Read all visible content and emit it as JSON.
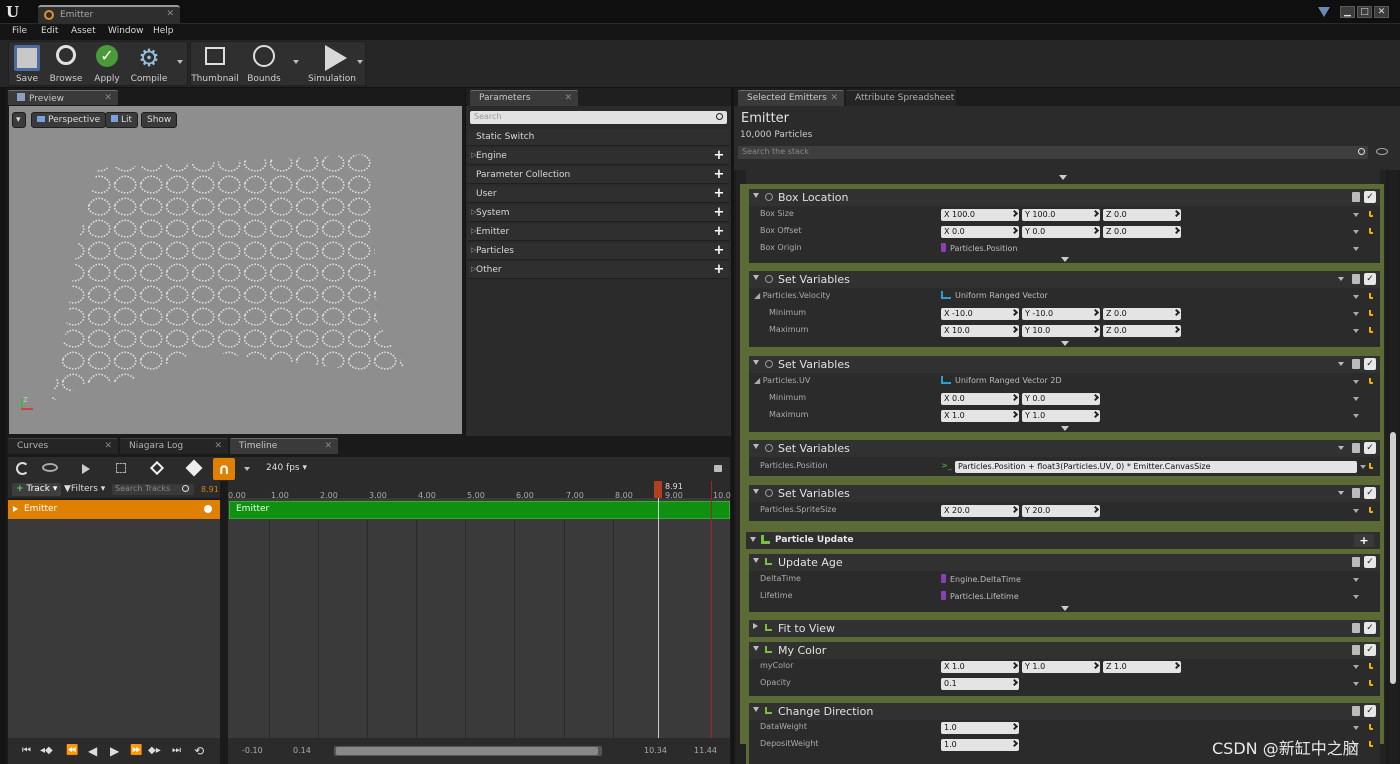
{
  "window": {
    "tab_title": "Emitter"
  },
  "menu": [
    "File",
    "Edit",
    "Asset",
    "Window",
    "Help"
  ],
  "toolbar": {
    "save": "Save",
    "browse": "Browse",
    "apply": "Apply",
    "compile": "Compile",
    "thumbnail": "Thumbnail",
    "bounds": "Bounds",
    "simulation": "Simulation"
  },
  "preview": {
    "tab": "Preview",
    "perspective": "Perspective",
    "lit": "Lit",
    "show": "Show"
  },
  "parameters": {
    "tab": "Parameters",
    "search_placeholder": "Search",
    "items": [
      "Static Switch",
      "Engine",
      "Parameter Collection",
      "User",
      "System",
      "Emitter",
      "Particles",
      "Other"
    ]
  },
  "right_tabs": {
    "selected_emitters": "Selected Emitters",
    "attribute_spreadsheet": "Attribute Spreadsheet"
  },
  "emitter": {
    "name": "Emitter",
    "particles": "10,000 Particles",
    "search_placeholder": "Search the stack"
  },
  "modules": {
    "box_location": {
      "title": "Box Location",
      "box_size": "Box Size",
      "box_offset": "Box Offset",
      "box_origin": "Box Origin",
      "size_x": "X 100.0",
      "size_y": "Y 100.0",
      "size_z": "Z 0.0",
      "off_x": "X 0.0",
      "off_y": "Y 0.0",
      "off_z": "Z 0.0",
      "origin": "Particles.Position"
    },
    "set_vars_velocity": {
      "title": "Set Variables",
      "param": "Particles.Velocity",
      "type": "Uniform Ranged Vector",
      "min": "Minimum",
      "max": "Maximum",
      "min_x": "X -10.0",
      "min_y": "Y -10.0",
      "min_z": "Z 0.0",
      "max_x": "X 10.0",
      "max_y": "Y 10.0",
      "max_z": "Z 0.0"
    },
    "set_vars_uv": {
      "title": "Set Variables",
      "param": "Particles.UV",
      "type": "Uniform Ranged Vector 2D",
      "min": "Minimum",
      "max": "Maximum",
      "min_x": "X 0.0",
      "min_y": "Y 0.0",
      "max_x": "X 1.0",
      "max_y": "Y 1.0"
    },
    "set_vars_position": {
      "title": "Set Variables",
      "param": "Particles.Position",
      "expr": "Particles.Position + float3(Particles.UV, 0) * Emitter.CanvasSize"
    },
    "set_vars_sprite": {
      "title": "Set Variables",
      "param": "Particles.SpriteSize",
      "x": "X 20.0",
      "y": "Y 20.0"
    },
    "particle_update": {
      "title": "Particle Update"
    },
    "update_age": {
      "title": "Update Age",
      "delta": "DeltaTime",
      "delta_val": "Engine.DeltaTime",
      "lifetime": "Lifetime",
      "lifetime_val": "Particles.Lifetime"
    },
    "fit_to_view": {
      "title": "Fit to View"
    },
    "my_color": {
      "title": "My Color",
      "color": "myColor",
      "x": "X 1.0",
      "y": "Y 1.0",
      "z": "Z 1.0",
      "opacity": "Opacity",
      "opacity_val": "0.1"
    },
    "change_direction": {
      "title": "Change Direction",
      "data_weight": "DataWeight",
      "dw_val": "1.0",
      "deposit_weight": "DepositWeight",
      "dep_val": "1.0"
    }
  },
  "bottom_tabs": {
    "curves": "Curves",
    "niagara_log": "Niagara Log",
    "timeline": "Timeline"
  },
  "timeline": {
    "fps": "240 fps",
    "track_btn": "Track",
    "filters": "Filters",
    "search_placeholder": "Search Tracks",
    "current_time": "8.91",
    "playhead_label": "8.91",
    "emitter_track": "Emitter",
    "emitter_bar": "Emitter",
    "ticks": [
      "0.00",
      "1.00",
      "2.00",
      "3.00",
      "4.00",
      "5.00",
      "6.00",
      "7.00",
      "8.00",
      "9.00",
      "10.0"
    ],
    "range_start": "-0.10",
    "range_in": "0.14",
    "range_out": "10.34",
    "range_end": "11.44"
  },
  "watermark": "CSDN @新缸中之脑"
}
